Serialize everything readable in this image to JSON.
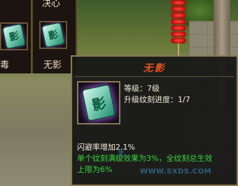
{
  "skill_grid": {
    "top_label_partial": "决心",
    "slots": [
      {
        "label": "毒",
        "tile_glyph": "影",
        "selected": false
      },
      {
        "label": "无影",
        "tile_glyph": "影",
        "selected": true
      }
    ]
  },
  "tooltip": {
    "title": "无影",
    "level_text": "等级：7级",
    "progress_text": "升级纹刻进度：1/7",
    "effect_text": "闪避率增加2.1%",
    "desc_line1": "单个纹刻满级效果为3%，全纹刻总生效",
    "desc_line2": "上限为6%",
    "icon": "jade-tile-icon"
  },
  "watermark": {
    "url": "WWW.SXDS.COM"
  },
  "colors": {
    "title": "#e2511e",
    "effect_green": "#38d43a",
    "border_gold": "#8a7a55"
  }
}
